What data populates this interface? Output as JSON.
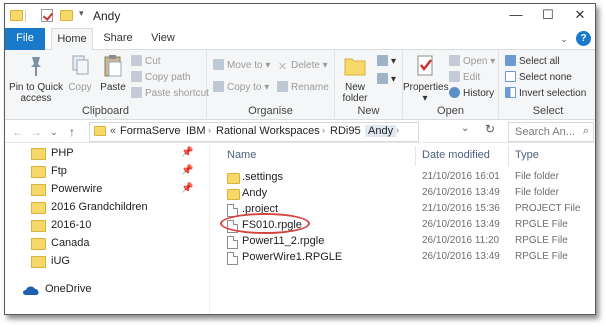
{
  "window": {
    "title": "Andy",
    "controls": {
      "minimize": "—",
      "maximize": "☐",
      "close": "✕"
    }
  },
  "ribbon_tabs": [
    "File",
    "Home",
    "Share",
    "View"
  ],
  "ribbon": {
    "clipboard": {
      "label": "Clipboard",
      "pin_to_quick_access": "Pin to Quick access",
      "copy": "Copy",
      "paste": "Paste",
      "cut": "Cut",
      "copy_path": "Copy path",
      "paste_shortcut": "Paste shortcut"
    },
    "organise": {
      "label": "Organise",
      "move_to": "Move to",
      "copy_to": "Copy to",
      "delete": "Delete",
      "rename": "Rename"
    },
    "new": {
      "label": "New",
      "new_folder": "New folder"
    },
    "open": {
      "label": "Open",
      "properties": "Properties",
      "open": "Open",
      "edit": "Edit",
      "history": "History"
    },
    "select": {
      "label": "Select",
      "select_all": "Select all",
      "select_none": "Select none",
      "invert_selection": "Invert selection"
    }
  },
  "address": {
    "overflow": "«",
    "breadcrumbs": [
      "FormaServe",
      "IBM",
      "Rational Workspaces",
      "RDi95",
      "Andy"
    ],
    "search_placeholder": "Search An..."
  },
  "nav_pane": {
    "items": [
      {
        "label": "PHP",
        "pinned": true
      },
      {
        "label": "Ftp",
        "pinned": true
      },
      {
        "label": "Powerwire",
        "pinned": true
      },
      {
        "label": "2016 Grandchildren",
        "pinned": false
      },
      {
        "label": "2016-10",
        "pinned": false
      },
      {
        "label": "Canada",
        "pinned": false
      },
      {
        "label": "iUG",
        "pinned": false
      }
    ],
    "onedrive": "OneDrive"
  },
  "file_list": {
    "columns": {
      "name": "Name",
      "date": "Date modified",
      "type": "Type"
    },
    "rows": [
      {
        "name": ".settings",
        "date": "21/10/2016 16:01",
        "type": "File folder",
        "icon": "folder"
      },
      {
        "name": "Andy",
        "date": "26/10/2016 13:49",
        "type": "File folder",
        "icon": "folder"
      },
      {
        "name": ".project",
        "date": "21/10/2016 15:36",
        "type": "PROJECT File",
        "icon": "file"
      },
      {
        "name": "FS010.rpgle",
        "date": "26/10/2016 13:49",
        "type": "RPGLE File",
        "icon": "file"
      },
      {
        "name": "Power11_2.rpgle",
        "date": "26/10/2016 11:20",
        "type": "RPGLE File",
        "icon": "file"
      },
      {
        "name": "PowerWire1.RPGLE",
        "date": "26/10/2016 13:49",
        "type": "RPGLE File",
        "icon": "file"
      }
    ],
    "highlighted": "FS010.rpgle"
  },
  "colors": {
    "file_tab": "#1979ca",
    "highlight_ellipse": "#d2443f",
    "folder": "#f6d86b"
  }
}
